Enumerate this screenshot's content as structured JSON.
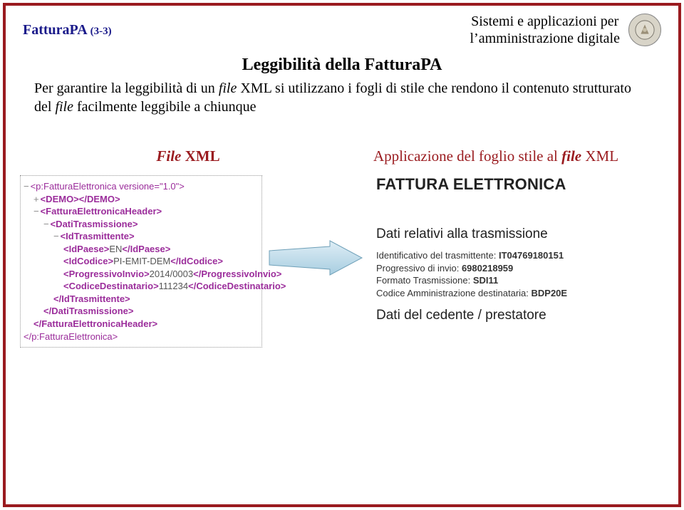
{
  "header": {
    "left_main": "FatturaPA",
    "left_sub": "(3-3)",
    "right_line1": "Sistemi e applicazioni per",
    "right_line2": "l’amministrazione digitale"
  },
  "title": "Leggibilità della FatturaPA",
  "intro": {
    "part1": "Per garantire la leggibilità di un ",
    "em1": "file",
    "part2": " XML si utilizzano i fogli di stile che rendono il contenuto strutturato del ",
    "em2": "file",
    "part3": " facilmente leggibile a chiunque"
  },
  "column_labels": {
    "left_file": "File",
    "left_xml": " XML",
    "right_prefix": "Applicazione del foglio stile al ",
    "right_file": "file",
    "right_xml": " XML"
  },
  "xml": {
    "l0_dash": "−",
    "l0": "<p:FatturaElettronica versione=\"1.0\">",
    "l1_dash": "+",
    "l1": "<DEMO></DEMO>",
    "l2_dash": "−",
    "l2": "<FatturaElettronicaHeader>",
    "l3_dash": "−",
    "l3": "<DatiTrasmissione>",
    "l4_dash": "−",
    "l4": "<IdTrasmittente>",
    "l5a": "<IdPaese>",
    "l5v": "EN",
    "l5b": "</IdPaese>",
    "l6a": "<IdCodice>",
    "l6v": "PI-EMIT-DEM",
    "l6b": "</IdCodice>",
    "l7a": "<ProgressivoInvio>",
    "l7v": "2014/0003",
    "l7b": "</ProgressivoInvio>",
    "l8a": "<CodiceDestinatario>",
    "l8v": "111234",
    "l8b": "</CodiceDestinatario>",
    "l9": "</IdTrasmittente>",
    "l10": "</DatiTrasmissione>",
    "l11": "</FatturaElettronicaHeader>",
    "l12": "</p:FatturaElettronica>"
  },
  "rendered": {
    "doc_title": "FATTURA ELETTRONICA",
    "section1": "Dati relativi alla trasmissione",
    "kv1_label": "Identificativo del trasmittente: ",
    "kv1_value": "IT04769180151",
    "kv2_label": "Progressivo di invio: ",
    "kv2_value": "6980218959",
    "kv3_label": "Formato Trasmissione: ",
    "kv3_value": "SDI11",
    "kv4_label": "Codice Amministrazione destinataria: ",
    "kv4_value": "BDP20E",
    "section2": "Dati del cedente / prestatore"
  }
}
